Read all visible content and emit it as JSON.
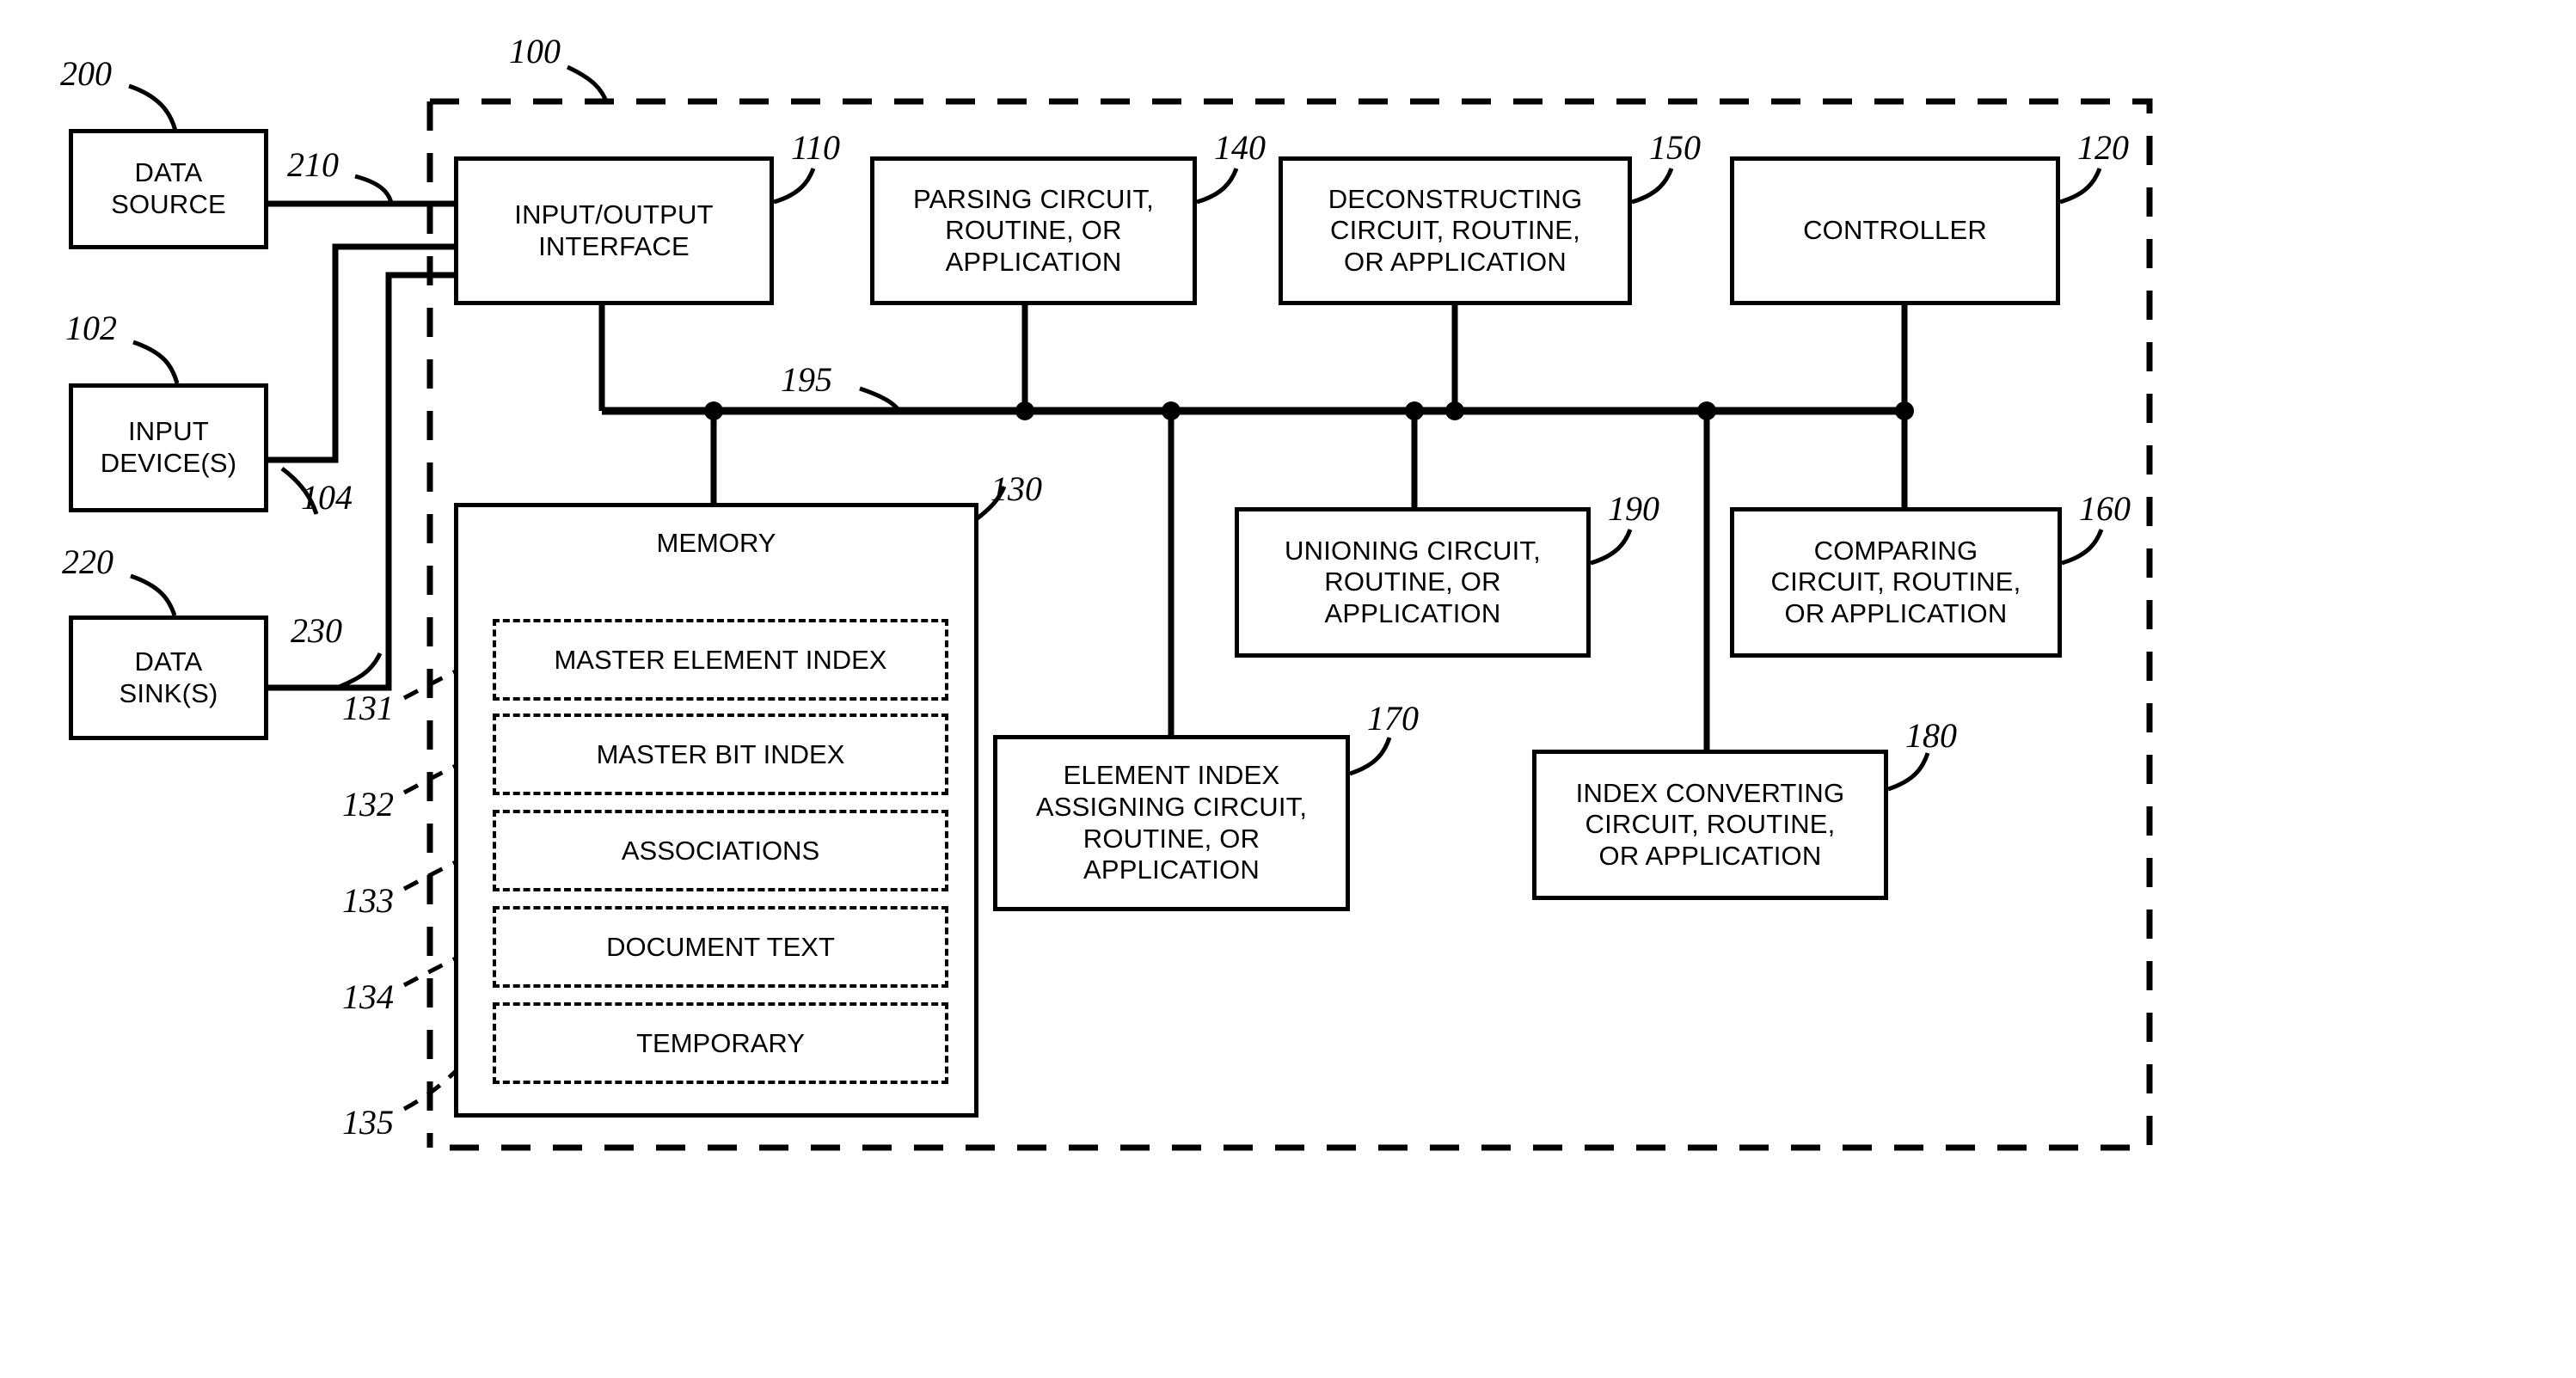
{
  "figure": {
    "type": "patent-block-diagram",
    "system_ref": "100",
    "bus_ref": "195"
  },
  "external_blocks": [
    {
      "id": "data-source",
      "label": "DATA\nSOURCE",
      "ref": "200",
      "link_ref": "210"
    },
    {
      "id": "input-device",
      "label": "INPUT\nDEVICE(S)",
      "ref": "102",
      "link_ref": "104"
    },
    {
      "id": "data-sink",
      "label": "DATA\nSINK(S)",
      "ref": "220",
      "link_ref": "230"
    }
  ],
  "system_blocks": [
    {
      "id": "io-interface",
      "label": "INPUT/OUTPUT\nINTERFACE",
      "ref": "110"
    },
    {
      "id": "parsing-circuit",
      "label": "PARSING CIRCUIT,\nROUTINE, OR\nAPPLICATION",
      "ref": "140"
    },
    {
      "id": "deconstructing-circuit",
      "label": "DECONSTRUCTING\nCIRCUIT, ROUTINE,\nOR APPLICATION",
      "ref": "150"
    },
    {
      "id": "controller",
      "label": "CONTROLLER",
      "ref": "120"
    },
    {
      "id": "unioning-circuit",
      "label": "UNIONING CIRCUIT,\nROUTINE, OR\nAPPLICATION",
      "ref": "190"
    },
    {
      "id": "comparing-circuit",
      "label": "COMPARING\nCIRCUIT, ROUTINE,\nOR APPLICATION",
      "ref": "160"
    },
    {
      "id": "element-index-circuit",
      "label": "ELEMENT INDEX\nASSIGNING CIRCUIT,\nROUTINE, OR\nAPPLICATION",
      "ref": "170"
    },
    {
      "id": "index-converting-circuit",
      "label": "INDEX CONVERTING\nCIRCUIT, ROUTINE,\nOR APPLICATION",
      "ref": "180"
    }
  ],
  "memory": {
    "title": "MEMORY",
    "ref": "130",
    "slots": [
      {
        "id": "master-element-index",
        "label": "MASTER ELEMENT INDEX",
        "ref": "131"
      },
      {
        "id": "master-bit-index",
        "label": "MASTER BIT INDEX",
        "ref": "132"
      },
      {
        "id": "associations",
        "label": "ASSOCIATIONS",
        "ref": "133"
      },
      {
        "id": "document-text",
        "label": "DOCUMENT TEXT",
        "ref": "134"
      },
      {
        "id": "temporary",
        "label": "TEMPORARY",
        "ref": "135"
      }
    ]
  },
  "colors": {
    "ink": "#000000",
    "paper": "#ffffff"
  }
}
